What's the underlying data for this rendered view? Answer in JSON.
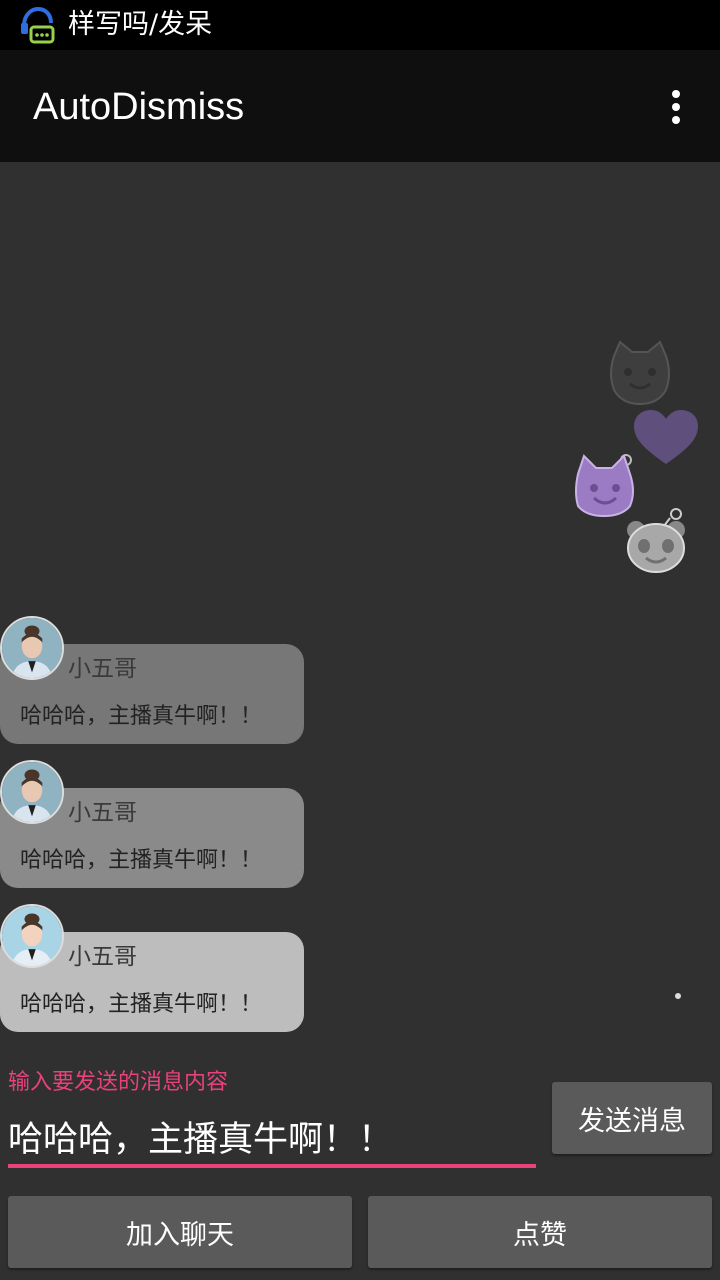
{
  "status_bar": {
    "notification_text": "样写吗/发呆",
    "app_icon": "chat-headset-icon"
  },
  "app_bar": {
    "title": "AutoDismiss",
    "menu_icon": "more-vert-icon"
  },
  "floating_likes": [
    {
      "icon": "cat-face-icon",
      "color": "#5a5a5a"
    },
    {
      "icon": "heart-icon",
      "color": "#6b5a8a"
    },
    {
      "icon": "cat-face-icon",
      "color": "#9b7bc4"
    },
    {
      "icon": "panda-face-icon",
      "color": "#a8a8a8"
    }
  ],
  "messages": [
    {
      "name": "小五哥",
      "text": "哈哈哈，主播真牛啊！！",
      "bubble_color": "#777777"
    },
    {
      "name": "小五哥",
      "text": "哈哈哈，主播真牛啊！！",
      "bubble_color": "#8a8a8a"
    },
    {
      "name": "小五哥",
      "text": "哈哈哈，主播真牛啊！！",
      "bubble_color": "#bdbdbd"
    }
  ],
  "composer": {
    "hint": "输入要发送的消息内容",
    "value": "哈哈哈，主播真牛啊！！",
    "accent_color": "#e9417c",
    "send_label": "发送消息"
  },
  "actions": {
    "join_label": "加入聊天",
    "like_label": "点赞"
  }
}
